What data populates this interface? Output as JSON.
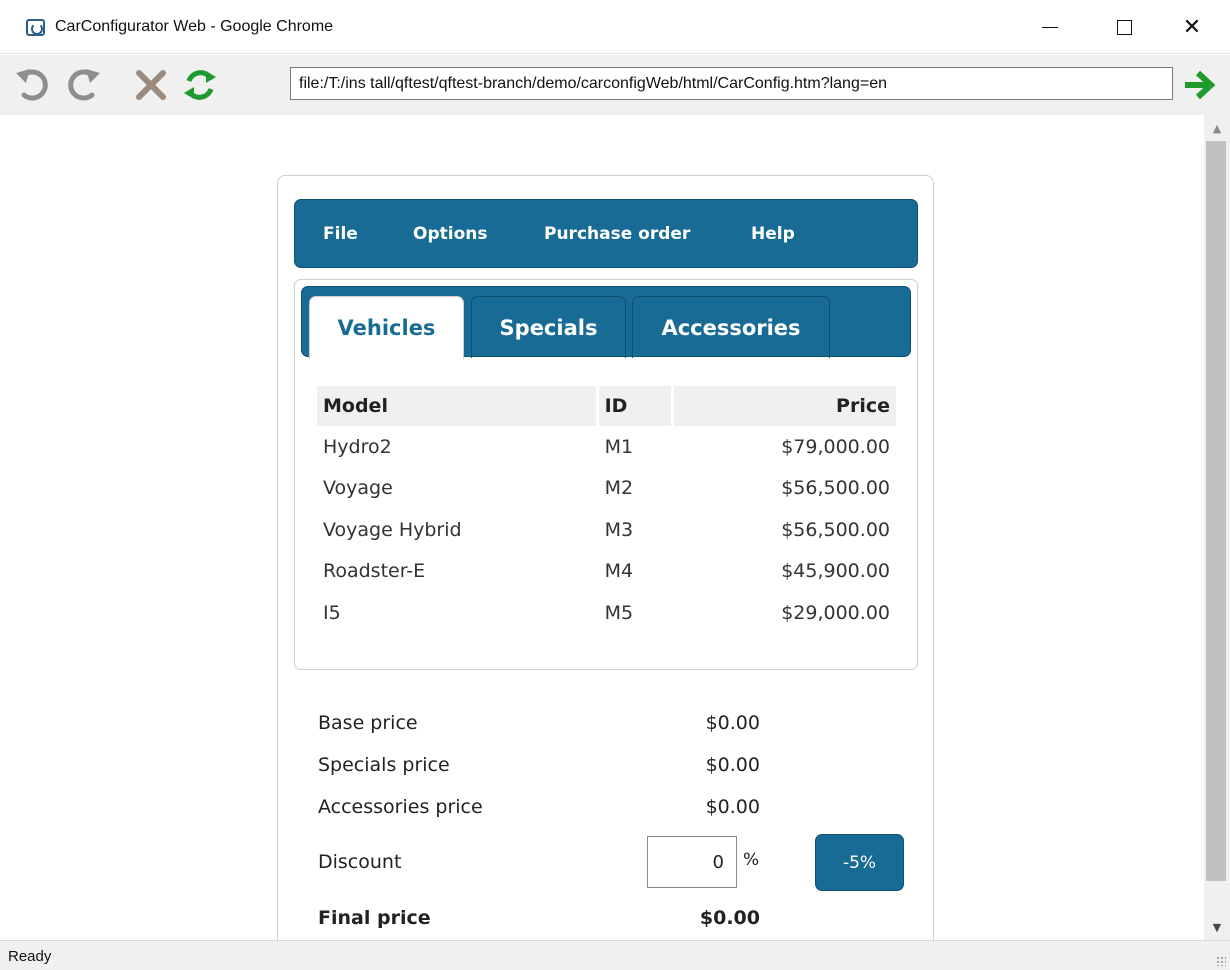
{
  "window": {
    "title": "CarConfigurator Web - Google Chrome",
    "close_glyph": "✕"
  },
  "toolbar": {
    "url": "file:/T:/ins tall/qftest/qftest-branch/demo/carconfigWeb/html/CarConfig.htm?lang=en",
    "icons": [
      "undo-icon",
      "redo-icon",
      "stop-icon",
      "reload-icon",
      "go-arrow-icon"
    ],
    "colors": {
      "disabled": "#8e8e8e",
      "stop": "#9b8b7e",
      "green": "#1e9b2c"
    }
  },
  "menu": {
    "items": [
      "File",
      "Options",
      "Purchase order",
      "Help"
    ]
  },
  "tabs": {
    "items": [
      "Vehicles",
      "Specials",
      "Accessories"
    ],
    "active": "Vehicles"
  },
  "vehicles_table": {
    "headers": [
      "Model",
      "ID",
      "Price"
    ],
    "rows": [
      [
        "Hydro2",
        "M1",
        "$79,000.00"
      ],
      [
        "Voyage",
        "M2",
        "$56,500.00"
      ],
      [
        "Voyage Hybrid",
        "M3",
        "$56,500.00"
      ],
      [
        "Roadster-E",
        "M4",
        "$45,900.00"
      ],
      [
        "I5",
        "M5",
        "$29,000.00"
      ]
    ]
  },
  "summary": {
    "base_label": "Base price",
    "base_value": "$0.00",
    "specials_label": "Specials price",
    "specials_value": "$0.00",
    "accessories_label": "Accessories price",
    "accessories_value": "$0.00",
    "discount_label": "Discount",
    "discount_value": "0",
    "discount_unit": "%",
    "discount_button": "-5%",
    "final_label": "Final price",
    "final_value": "$0.00"
  },
  "status": {
    "text": "Ready"
  },
  "theme": {
    "accent": "#186b95",
    "panel_border": "#cfcfcf"
  }
}
